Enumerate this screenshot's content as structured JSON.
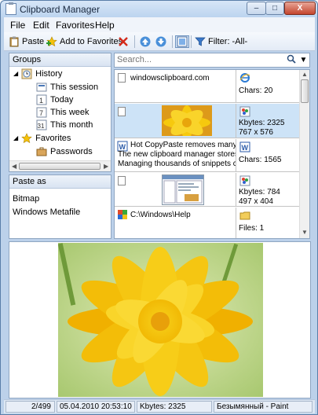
{
  "window": {
    "title": "Clipboard Manager"
  },
  "title_buttons": {
    "minimize": "–",
    "maximize": "□",
    "close": "X"
  },
  "menu": [
    "File",
    "Edit",
    "Favorites",
    "Help"
  ],
  "toolbar": {
    "paste_label": "Paste",
    "add_favorites_label": "Add to Favorites",
    "filter_label": "Filter: -All-"
  },
  "groups": {
    "header": "Groups",
    "history_label": "History",
    "items": [
      "This session",
      "Today",
      "This week",
      "This month"
    ],
    "favorites_label": "Favorites",
    "favorites_items": [
      "Passwords"
    ]
  },
  "paste_as": {
    "header": "Paste as",
    "items": [
      "Bitmap",
      "Windows Metafile"
    ]
  },
  "search": {
    "placeholder": "Search..."
  },
  "clips": [
    {
      "type": "link",
      "text": "windowsclipboard.com",
      "icon": "ie-icon",
      "info": [
        "",
        "Chars: 20"
      ]
    },
    {
      "type": "image",
      "thumbnail": "yellow-flower",
      "icon": "paint-icon",
      "info": [
        "Kbytes: 2325",
        "767 x 576"
      ],
      "selected": true
    },
    {
      "type": "text",
      "lines": [
        "Hot CopyPaste removes many ann",
        "The new clipboard manager stores",
        "Managing thousands of snippets c"
      ],
      "icon": "word-icon",
      "info": [
        "Chars: 1565"
      ]
    },
    {
      "type": "image",
      "thumbnail": "screenshot",
      "icon": "paint-icon",
      "info": [
        "Kbytes: 784",
        "497 x 404"
      ]
    },
    {
      "type": "files",
      "text": "C:\\Windows\\Help",
      "icon": "folder-icon",
      "info": [
        "Files: 1"
      ]
    }
  ],
  "status": {
    "position": "2/499",
    "timestamp": "05.04.2010 20:53:10",
    "size": "Kbytes: 2325",
    "source": "Безымянный - Paint"
  },
  "colors": {
    "window_frame": "#bcd1ea",
    "selection": "#cde3f7",
    "flower": "#f5c400",
    "flower_bg": "#c8df8a"
  }
}
